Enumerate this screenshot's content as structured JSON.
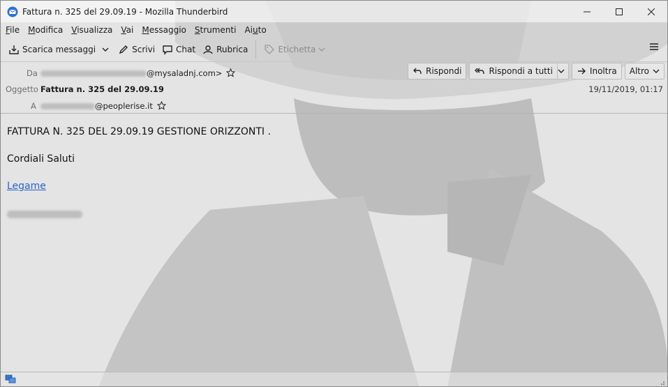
{
  "window": {
    "title": "Fattura n. 325 del 29.09.19 - Mozilla Thunderbird"
  },
  "menu": {
    "items": [
      {
        "label": "File",
        "key": "F",
        "rest": "ile"
      },
      {
        "label": "Modifica",
        "key": "M",
        "rest": "odifica"
      },
      {
        "label": "Visualizza",
        "key": "V",
        "rest": "isualizza"
      },
      {
        "label": "Vai",
        "key": "V",
        "rest": "ai"
      },
      {
        "label": "Messaggio",
        "key": "M",
        "rest": "essaggio"
      },
      {
        "label": "Strumenti",
        "key": "S",
        "rest": "trumenti"
      },
      {
        "label": "Aiuto",
        "key": "A",
        "rest": "iuto"
      }
    ]
  },
  "toolbar": {
    "get_messages": "Scarica messaggi",
    "write": "Scrivi",
    "chat": "Chat",
    "address_book": "Rubrica",
    "tag": "Etichetta"
  },
  "header": {
    "from_label": "Da",
    "from_domain": "@mysaladnj.com>",
    "subject_label": "Oggetto",
    "subject": "Fattura n. 325 del 29.09.19",
    "to_label": "A",
    "to_domain": "@peoplerise.it",
    "date": "19/11/2019, 01:17"
  },
  "actions": {
    "reply": "Rispondi",
    "reply_all": "Rispondi a tutti",
    "forward": "Inoltra",
    "more": "Altro"
  },
  "body": {
    "line1": "FATTURA N. 325 DEL 29.09.19 GESTIONE ORIZZONTI .",
    "line2": "Cordiali Saluti",
    "link": "Legame"
  },
  "colors": {
    "link": "#2a62c9",
    "background": "#e2e2e2"
  }
}
